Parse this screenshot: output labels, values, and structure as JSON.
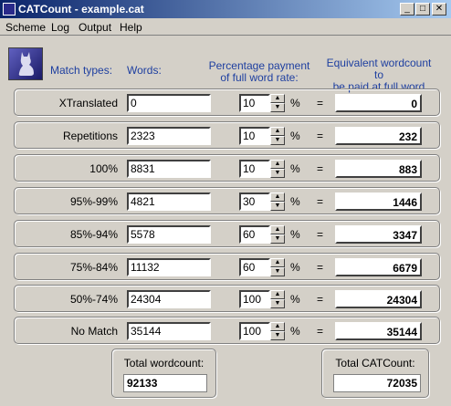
{
  "window": {
    "title": "CATCount - example.cat",
    "minimize": "_",
    "maximize": "□",
    "close": "✕"
  },
  "menu": [
    "Scheme",
    "Log",
    "Output",
    "Help"
  ],
  "headers": {
    "match_types": "Match types:",
    "words": "Words:",
    "percentage_line1": "Percentage payment",
    "percentage_line2": "of full word rate:",
    "equivalent_line1": "Equivalent wordcount to",
    "equivalent_line2": "be paid at full word rate:"
  },
  "symbols": {
    "percent": "%",
    "equals": "="
  },
  "rows": [
    {
      "label": "XTranslated",
      "words": "0",
      "percent": "10",
      "result": "0"
    },
    {
      "label": "Repetitions",
      "words": "2323",
      "percent": "10",
      "result": "232"
    },
    {
      "label": "100%",
      "words": "8831",
      "percent": "10",
      "result": "883"
    },
    {
      "label": "95%-99%",
      "words": "4821",
      "percent": "30",
      "result": "1446"
    },
    {
      "label": "85%-94%",
      "words": "5578",
      "percent": "60",
      "result": "3347"
    },
    {
      "label": "75%-84%",
      "words": "11132",
      "percent": "60",
      "result": "6679"
    },
    {
      "label": "50%-74%",
      "words": "24304",
      "percent": "100",
      "result": "24304"
    },
    {
      "label": "No Match",
      "words": "35144",
      "percent": "100",
      "result": "35144"
    }
  ],
  "totals": {
    "wordcount_label": "Total wordcount:",
    "wordcount_value": "92133",
    "catcount_label": "Total CATCount:",
    "catcount_value": "72035"
  },
  "icons": {
    "app": "cat-app-icon",
    "logo": "cat-logo-icon",
    "spin_up": "spin-up-arrow-icon",
    "spin_down": "spin-down-arrow-icon"
  },
  "colors": {
    "titlebar_start": "#0a246a",
    "titlebar_end": "#a6caf0",
    "header_text": "#1e3fa0",
    "window_bg": "#d4d0c8"
  }
}
